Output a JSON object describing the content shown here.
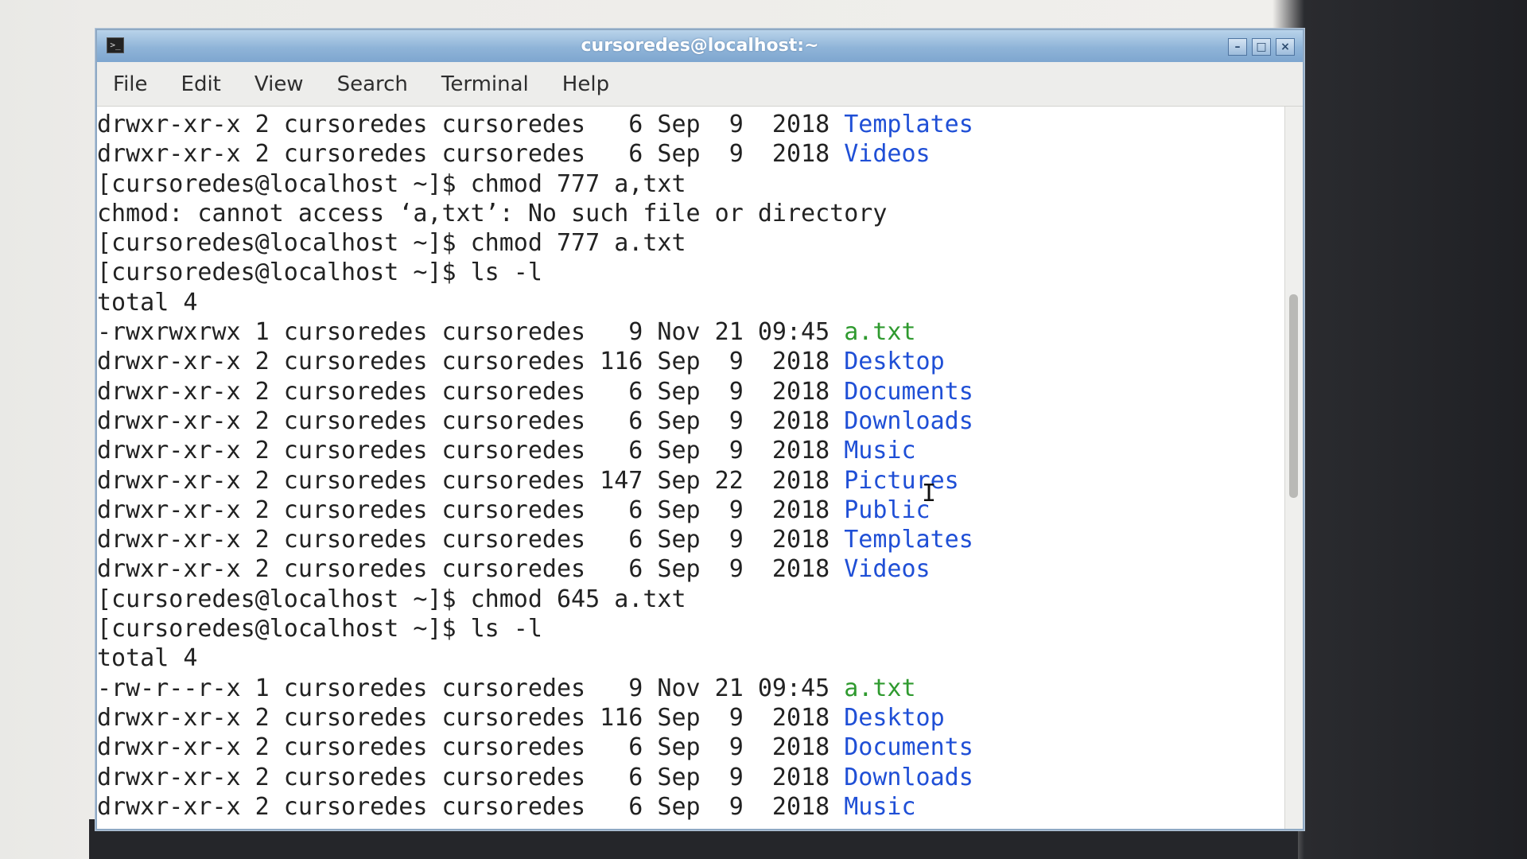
{
  "window": {
    "title": "cursoredes@localhost:~",
    "icon": "terminal-icon",
    "controls": {
      "minimize": "–",
      "maximize": "□",
      "close": "×"
    }
  },
  "menubar": {
    "items": [
      "File",
      "Edit",
      "View",
      "Search",
      "Terminal",
      "Help"
    ]
  },
  "terminal": {
    "lines": [
      {
        "text": "drwxr-xr-x 2 cursoredes cursoredes   6 Sep  9  2018 ",
        "name": "Templates",
        "kind": "dir"
      },
      {
        "text": "drwxr-xr-x 2 cursoredes cursoredes   6 Sep  9  2018 ",
        "name": "Videos",
        "kind": "dir"
      },
      {
        "text": "[cursoredes@localhost ~]$ chmod 777 a,txt",
        "name": "",
        "kind": ""
      },
      {
        "text": "chmod: cannot access ‘a,txt’: No such file or directory",
        "name": "",
        "kind": ""
      },
      {
        "text": "[cursoredes@localhost ~]$ chmod 777 a.txt",
        "name": "",
        "kind": ""
      },
      {
        "text": "[cursoredes@localhost ~]$ ls -l",
        "name": "",
        "kind": ""
      },
      {
        "text": "total 4",
        "name": "",
        "kind": ""
      },
      {
        "text": "-rwxrwxrwx 1 cursoredes cursoredes   9 Nov 21 09:45 ",
        "name": "a.txt",
        "kind": "exe"
      },
      {
        "text": "drwxr-xr-x 2 cursoredes cursoredes 116 Sep  9  2018 ",
        "name": "Desktop",
        "kind": "dir"
      },
      {
        "text": "drwxr-xr-x 2 cursoredes cursoredes   6 Sep  9  2018 ",
        "name": "Documents",
        "kind": "dir"
      },
      {
        "text": "drwxr-xr-x 2 cursoredes cursoredes   6 Sep  9  2018 ",
        "name": "Downloads",
        "kind": "dir"
      },
      {
        "text": "drwxr-xr-x 2 cursoredes cursoredes   6 Sep  9  2018 ",
        "name": "Music",
        "kind": "dir"
      },
      {
        "text": "drwxr-xr-x 2 cursoredes cursoredes 147 Sep 22  2018 ",
        "name": "Pictures",
        "kind": "dir"
      },
      {
        "text": "drwxr-xr-x 2 cursoredes cursoredes   6 Sep  9  2018 ",
        "name": "Public",
        "kind": "dir"
      },
      {
        "text": "drwxr-xr-x 2 cursoredes cursoredes   6 Sep  9  2018 ",
        "name": "Templates",
        "kind": "dir"
      },
      {
        "text": "drwxr-xr-x 2 cursoredes cursoredes   6 Sep  9  2018 ",
        "name": "Videos",
        "kind": "dir"
      },
      {
        "text": "[cursoredes@localhost ~]$ chmod 645 a.txt",
        "name": "",
        "kind": ""
      },
      {
        "text": "[cursoredes@localhost ~]$ ls -l",
        "name": "",
        "kind": ""
      },
      {
        "text": "total 4",
        "name": "",
        "kind": ""
      },
      {
        "text": "-rw-r--r-x 1 cursoredes cursoredes   9 Nov 21 09:45 ",
        "name": "a.txt",
        "kind": "exe"
      },
      {
        "text": "drwxr-xr-x 2 cursoredes cursoredes 116 Sep  9  2018 ",
        "name": "Desktop",
        "kind": "dir"
      },
      {
        "text": "drwxr-xr-x 2 cursoredes cursoredes   6 Sep  9  2018 ",
        "name": "Documents",
        "kind": "dir"
      },
      {
        "text": "drwxr-xr-x 2 cursoredes cursoredes   6 Sep  9  2018 ",
        "name": "Downloads",
        "kind": "dir"
      },
      {
        "text": "drwxr-xr-x 2 cursoredes cursoredes   6 Sep  9  2018 ",
        "name": "Music",
        "kind": "dir"
      }
    ]
  },
  "colors": {
    "directory": "#1f4fd6",
    "executable": "#2f9a2f",
    "text": "#222222",
    "titlebar": "#8fb4d8"
  }
}
